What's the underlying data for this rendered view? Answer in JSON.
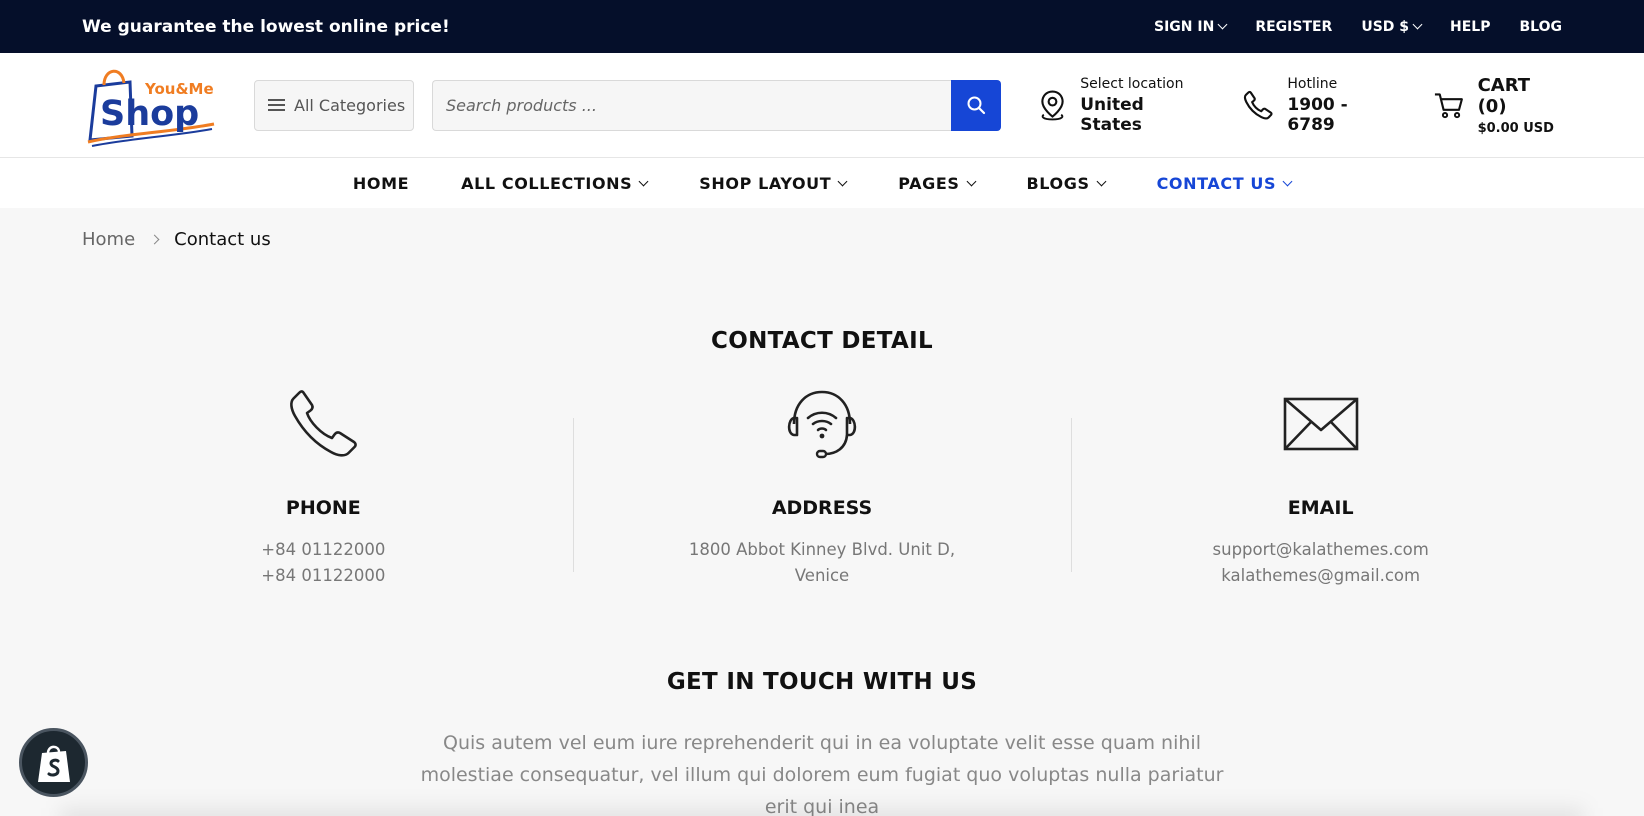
{
  "topbar": {
    "promo": "We guarantee the lowest online price!",
    "sign_in": "SIGN IN",
    "register": "REGISTER",
    "currency": "USD $",
    "help": "HELP",
    "blog": "BLOG"
  },
  "header": {
    "logo_top": "You&Me",
    "logo_main": "Shop",
    "categories_label": "All Categories",
    "search_placeholder": "Search products ...",
    "location_label": "Select location",
    "location_value": "United States",
    "hotline_label": "Hotline",
    "hotline_value": "1900 - 6789",
    "cart_label": "CART (0)",
    "cart_total": "$0.00 USD"
  },
  "nav": {
    "items": [
      {
        "label": "HOME"
      },
      {
        "label": "ALL COLLECTIONS"
      },
      {
        "label": "SHOP LAYOUT"
      },
      {
        "label": "PAGES"
      },
      {
        "label": "BLOGS"
      },
      {
        "label": "CONTACT US"
      }
    ]
  },
  "breadcrumb": {
    "home": "Home",
    "current": "Contact us"
  },
  "contact": {
    "title": "CONTACT DETAIL",
    "phone": {
      "title": "PHONE",
      "line1": "+84 01122000",
      "line2": "+84 01122000",
      "icon": "phone-icon"
    },
    "address": {
      "title": "ADDRESS",
      "line1": "1800 Abbot Kinney Blvd. Unit D,",
      "line2": "Venice",
      "icon": "headset-icon"
    },
    "email": {
      "title": "EMAIL",
      "line1": "support@kalathemes.com",
      "line2": "kalathemes@gmail.com",
      "icon": "envelope-icon"
    }
  },
  "get_in_touch": {
    "title": "GET IN TOUCH WITH US",
    "text": "Quis autem vel eum iure reprehenderit qui in ea voluptate velit esse quam nihil molestiae consequatur, vel illum qui dolorem eum fugiat quo voluptas nulla pariatur erit qui inea"
  },
  "colors": {
    "topbar_bg": "#050f2a",
    "accent": "#1646d6",
    "logo_orange": "#f07d22"
  }
}
